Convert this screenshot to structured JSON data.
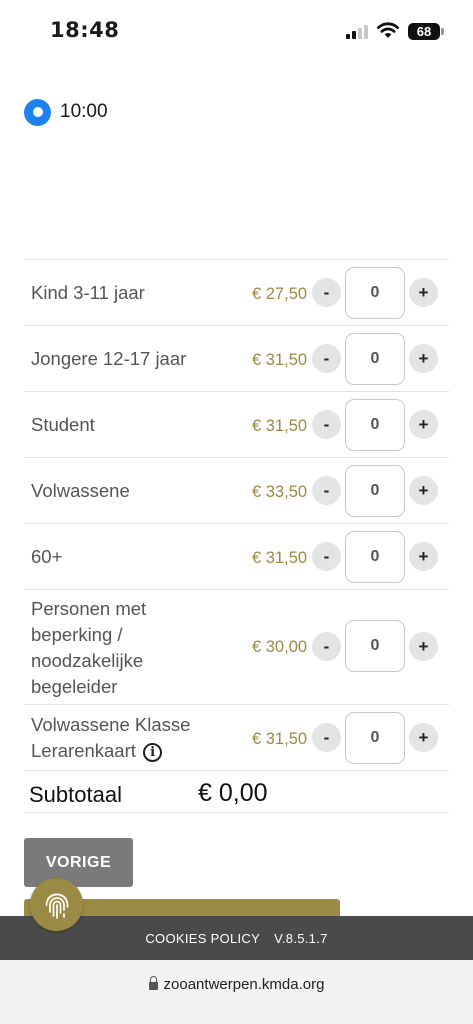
{
  "status_bar": {
    "time": "18:48",
    "battery": "68",
    "icons": [
      "cellular-signal-icon",
      "wifi-icon",
      "battery-icon"
    ]
  },
  "time_slot": {
    "selected": true,
    "label": "10:00"
  },
  "currency_color": "#9a8a43",
  "radio_color": "#1b82f0",
  "tickets": [
    {
      "name": "Kind 3-11 jaar",
      "price": "€ 27,50",
      "quantity": "0",
      "minus": "-",
      "plus": "+"
    },
    {
      "name": "Jongere 12-17 jaar",
      "price": "€ 31,50",
      "quantity": "0",
      "minus": "-",
      "plus": "+"
    },
    {
      "name": "Student",
      "price": "€ 31,50",
      "quantity": "0",
      "minus": "-",
      "plus": "+"
    },
    {
      "name": "Volwassene",
      "price": "€ 33,50",
      "quantity": "0",
      "minus": "-",
      "plus": "+"
    },
    {
      "name": "60+",
      "price": "€ 31,50",
      "quantity": "0",
      "minus": "-",
      "plus": "+"
    },
    {
      "name": "Personen met beperking / noodzakelijke begeleider",
      "price": "€ 30,00",
      "quantity": "0",
      "minus": "-",
      "plus": "+"
    },
    {
      "name": "Volwassene Klasse Lerarenkaart",
      "price": "€ 31,50",
      "quantity": "0",
      "minus": "-",
      "plus": "+",
      "info_icon": "i"
    }
  ],
  "subtotal": {
    "label": "Subtotaal",
    "value": "€ 0,00"
  },
  "buttons": {
    "previous": "VORIGE"
  },
  "footer": {
    "cookies_policy": "COOKIES POLICY",
    "version": "V.8.5.1.7"
  },
  "browser": {
    "url": "zooantwerpen.kmda.org"
  }
}
